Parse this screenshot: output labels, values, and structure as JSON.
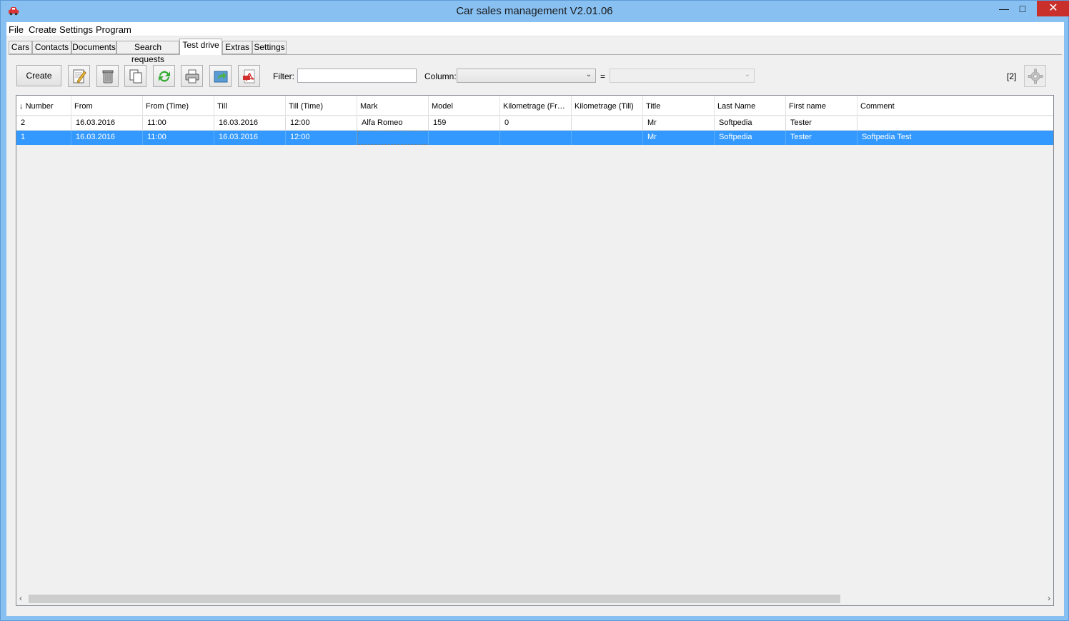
{
  "window": {
    "title": "Car sales management V2.01.06",
    "minimize": "—",
    "maximize": "□",
    "close": "✕"
  },
  "menu": [
    "File",
    "Create",
    "Settings",
    "Program"
  ],
  "tabs": [
    "Cars",
    "Contacts",
    "Documents",
    "Search requests",
    "Test drive",
    "Extras",
    "Settings"
  ],
  "active_tab": "Test drive",
  "toolbar": {
    "create_label": "Create",
    "filter_label": "Filter:",
    "filter_value": "",
    "column_label": "Column:",
    "column_value": "",
    "equals_label": "=",
    "value_select": "",
    "record_count": "[2]",
    "icons": [
      "edit-icon",
      "delete-icon",
      "copy-icon",
      "refresh-icon",
      "print-icon",
      "export-icon",
      "pdf-icon",
      "settings-gear-icon"
    ]
  },
  "table": {
    "sort_indicator": "↓",
    "columns": [
      "Number",
      "From",
      "From (Time)",
      "Till",
      "Till (Time)",
      "Mark",
      "Model",
      "Kilometrage (Fr…",
      "Kilometrage (Till)",
      "Title",
      "Last Name",
      "First name",
      "Comment"
    ],
    "rows": [
      [
        "2",
        "16.03.2016",
        "11:00",
        "16.03.2016",
        "12:00",
        "Alfa Romeo",
        "159",
        "0",
        "",
        "Mr",
        "Softpedia",
        "Tester",
        ""
      ],
      [
        "1",
        "16.03.2016",
        "11:00",
        "16.03.2016",
        "12:00",
        "",
        "",
        "",
        "",
        "Mr",
        "Softpedia",
        "Tester",
        "Softpedia Test"
      ]
    ],
    "selected_row": 1
  },
  "colors": {
    "titlebar": "#88c0f2",
    "selection": "#3399ff",
    "close_button": "#c9302c"
  }
}
